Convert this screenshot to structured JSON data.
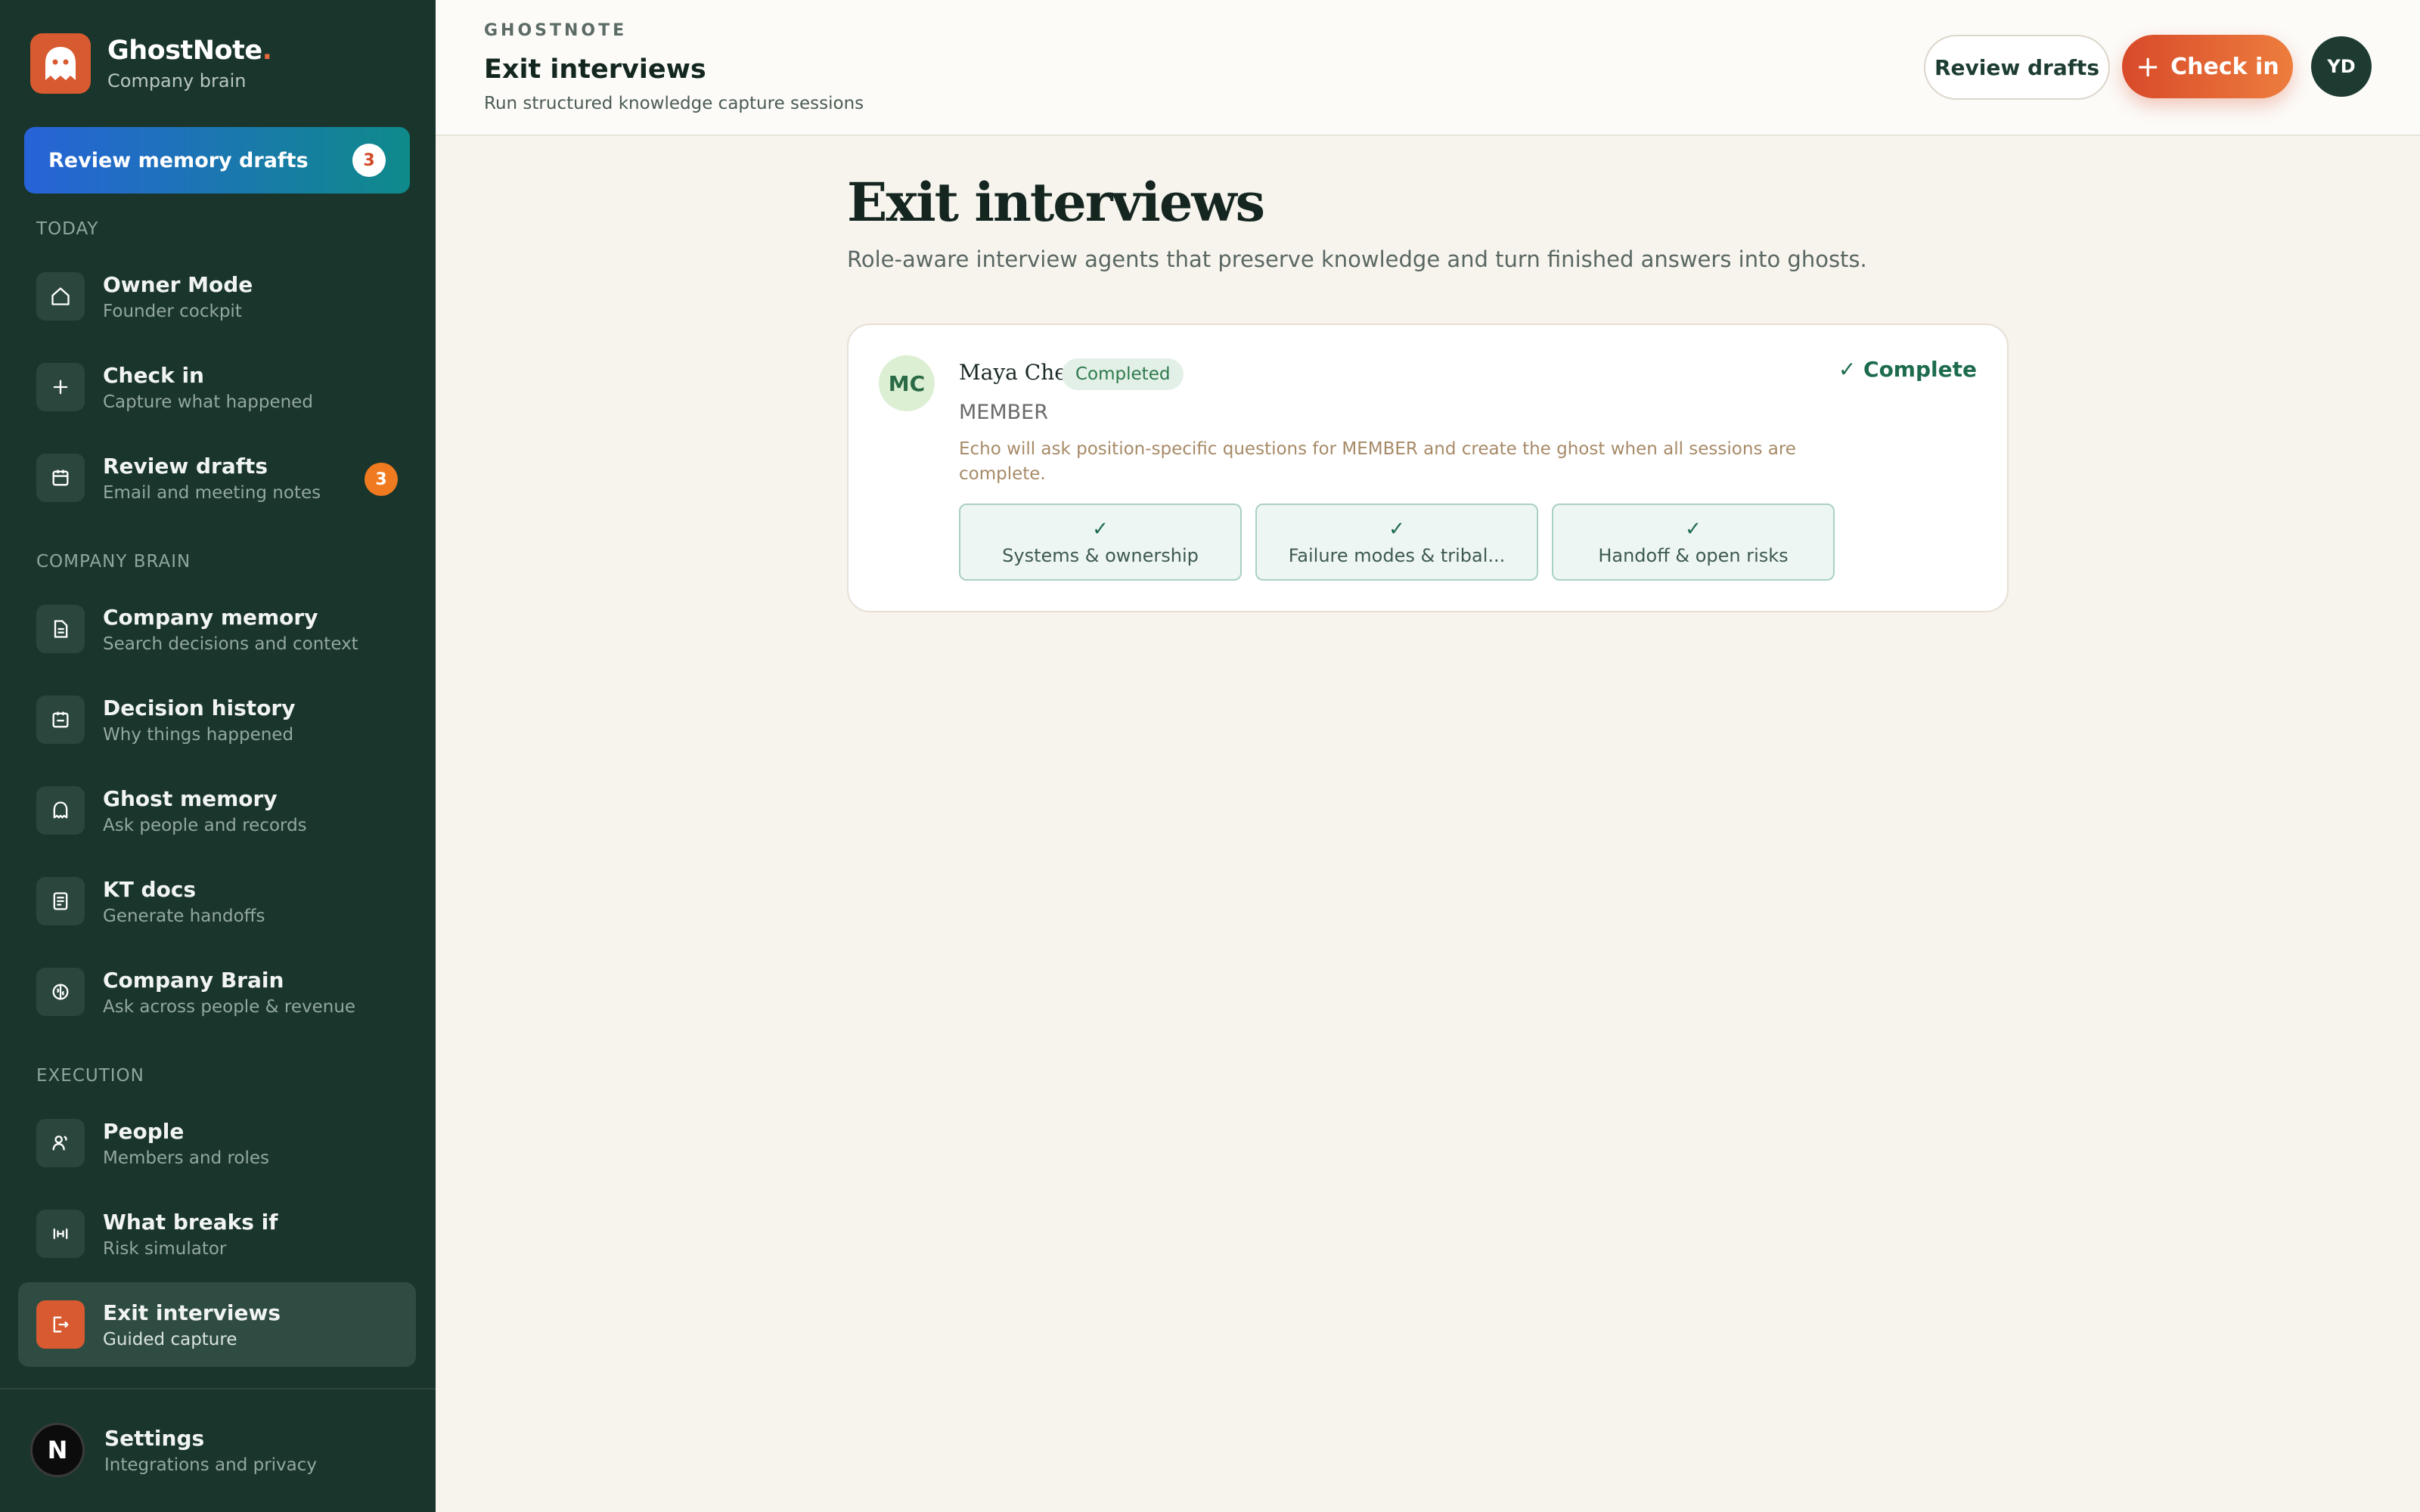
{
  "brand": {
    "name": "GhostNote",
    "dot": ".",
    "subtitle": "Company brain"
  },
  "review_cta": {
    "label": "Review memory drafts",
    "count": "3"
  },
  "sections": {
    "today": "TODAY",
    "company_brain": "COMPANY BRAIN",
    "execution": "EXECUTION"
  },
  "nav": {
    "owner_mode": {
      "label": "Owner Mode",
      "sub": "Founder cockpit",
      "icon": "home-icon"
    },
    "check_in": {
      "label": "Check in",
      "sub": "Capture what happened",
      "icon": "plus-icon"
    },
    "review_drafts": {
      "label": "Review drafts",
      "sub": "Email and meeting notes",
      "badge": "3",
      "icon": "calendar-icon"
    },
    "company_memory": {
      "label": "Company memory",
      "sub": "Search decisions and context",
      "icon": "document-icon"
    },
    "decision_history": {
      "label": "Decision history",
      "sub": "Why things happened",
      "icon": "calendar-check-icon"
    },
    "ghost_memory": {
      "label": "Ghost memory",
      "sub": "Ask people and records",
      "icon": "ghost-icon"
    },
    "kt_docs": {
      "label": "KT docs",
      "sub": "Generate handoffs",
      "icon": "file-text-icon"
    },
    "company_brain": {
      "label": "Company Brain",
      "sub": "Ask across people & revenue",
      "icon": "brain-icon"
    },
    "people": {
      "label": "People",
      "sub": "Members and roles",
      "icon": "users-icon"
    },
    "what_breaks_if": {
      "label": "What breaks if",
      "sub": "Risk simulator",
      "icon": "dumbbell-icon"
    },
    "exit_interviews": {
      "label": "Exit interviews",
      "sub": "Guided capture",
      "icon": "door-exit-icon"
    }
  },
  "settings": {
    "avatar": "N",
    "label": "Settings",
    "sub": "Integrations and privacy"
  },
  "header": {
    "eyebrow": "GHOSTNOTE",
    "title": "Exit interviews",
    "subtitle": "Run structured knowledge capture sessions",
    "review_button": "Review drafts",
    "checkin_button": "Check in",
    "user_initials": "YD"
  },
  "main": {
    "title": "Exit interviews",
    "subtitle": "Role-aware interview agents that preserve knowledge and turn finished answers into ghosts."
  },
  "interview": {
    "initials": "MC",
    "name": "Maya Chen",
    "status": "Completed",
    "role": "MEMBER",
    "description": "Echo will ask position-specific questions for MEMBER and create the ghost when all sessions are complete.",
    "complete_label": "✓ Complete",
    "steps": [
      {
        "check": "✓",
        "label": "Systems & ownership"
      },
      {
        "check": "✓",
        "label": "Failure modes & tribal..."
      },
      {
        "check": "✓",
        "label": "Handoff & open risks"
      }
    ]
  },
  "colors": {
    "sidebar": "#19352c",
    "accent": "#d85a30",
    "success": "#2d7a4d"
  }
}
